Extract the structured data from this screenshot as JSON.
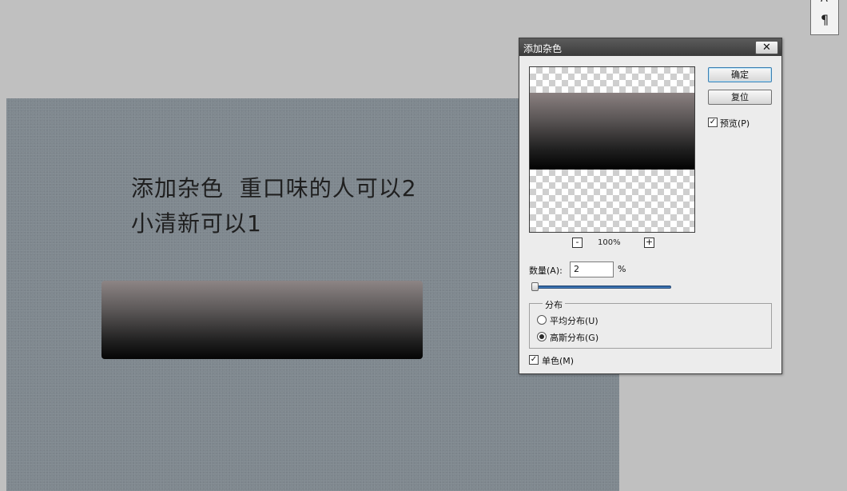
{
  "panel": {
    "glyph_top": "A",
    "glyph_paragraph": "¶"
  },
  "canvas": {
    "text_line1": "添加杂色  重口味的人可以2",
    "text_line2": "小清新可以1"
  },
  "dialog": {
    "title": "添加杂色",
    "close_label": "✕",
    "ok_label": "确定",
    "reset_label": "复位",
    "preview_label": "预览(P)",
    "preview_checked": true,
    "zoom_out_label": "-",
    "zoom_in_label": "+",
    "zoom_level": "100%",
    "amount_label": "数量(A):",
    "amount_value": "2",
    "amount_unit": "%",
    "amount_slider_fraction": 0.01,
    "distribution_label": "分布",
    "distribution_options": [
      "平均分布(U)",
      "高斯分布(G)"
    ],
    "distribution_selected": "高斯分布(G)",
    "mono_label": "单色(M)",
    "mono_checked": true
  },
  "colors": {
    "canvas_bg": "#7f888f",
    "dialog_bg": "#ececec",
    "titlebar": "#4a4a4a",
    "slider": "#2f6db0"
  }
}
